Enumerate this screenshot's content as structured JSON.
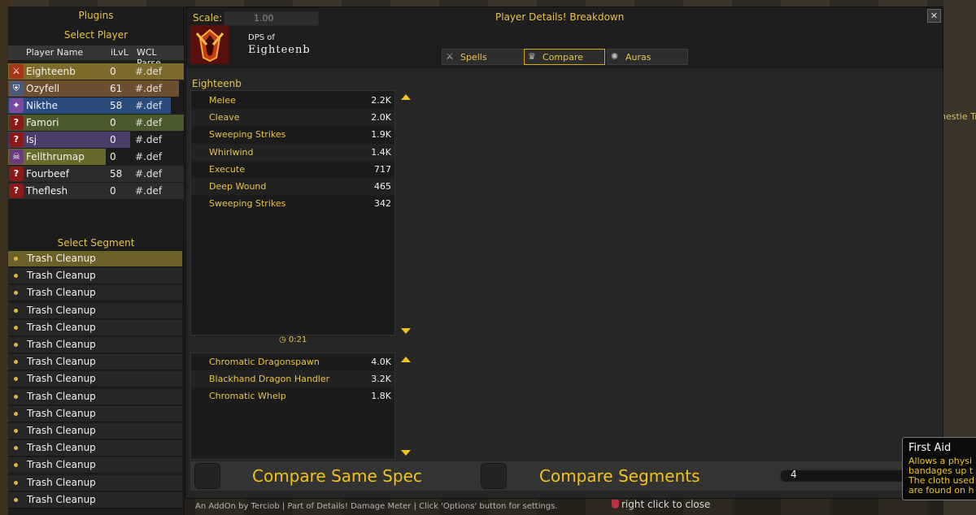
{
  "plugins_title": "Plugins",
  "select_player_title": "Select Player",
  "player_table": {
    "headers": [
      "Player Name",
      "iLvL",
      "WCL Parse"
    ],
    "rows": [
      {
        "name": "Eighteenb",
        "ilvl": "0",
        "parse": "#.def",
        "bar": "#7c6b2a",
        "icon": "warrior-icon"
      },
      {
        "name": "Ozyfell",
        "ilvl": "61",
        "parse": "#.def",
        "bar": "#6d4f30",
        "icon": "shield-icon"
      },
      {
        "name": "Nikthe",
        "ilvl": "58",
        "parse": "#.def",
        "bar": "#2a4c7c",
        "icon": "mage-icon"
      },
      {
        "name": "Famori",
        "ilvl": "0",
        "parse": "#.def",
        "bar": "#4a5a2a",
        "icon": "question-icon"
      },
      {
        "name": "Isj",
        "ilvl": "0",
        "parse": "#.def",
        "bar": "#4a3d6a",
        "icon": "question-icon"
      },
      {
        "name": "Fellthrumap",
        "ilvl": "0",
        "parse": "#.def",
        "bar": "#676a2a",
        "icon": "warlock-icon"
      },
      {
        "name": "Fourbeef",
        "ilvl": "58",
        "parse": "#.def",
        "bar": "#2c2c2c",
        "icon": "question-icon"
      },
      {
        "name": "Theflesh",
        "ilvl": "0",
        "parse": "#.def",
        "bar": "#2c2c2c",
        "icon": "question-icon"
      }
    ]
  },
  "select_segment_title": "Select Segment",
  "segments": [
    "Trash Cleanup",
    "Trash Cleanup",
    "Trash Cleanup",
    "Trash Cleanup",
    "Trash Cleanup",
    "Trash Cleanup",
    "Trash Cleanup",
    "Trash Cleanup",
    "Trash Cleanup",
    "Trash Cleanup",
    "Trash Cleanup",
    "Trash Cleanup",
    "Trash Cleanup",
    "Trash Cleanup",
    "Trash Cleanup"
  ],
  "window": {
    "scale_label": "Scale:",
    "scale_value": "1.00",
    "title": "Player Details! Breakdown",
    "close": "✕",
    "dps_of": "DPS of",
    "player_name": "Eighteenb",
    "tabs": [
      {
        "label": "Spells",
        "icon": "swords-icon"
      },
      {
        "label": "Compare",
        "icon": "crown-icon"
      },
      {
        "label": "Auras",
        "icon": "auras-icon"
      }
    ]
  },
  "breakdown": {
    "player": "Eighteenb",
    "spells": [
      {
        "name": "Melee",
        "value": "2.2K"
      },
      {
        "name": "Cleave",
        "value": "2.0K"
      },
      {
        "name": "Sweeping Strikes",
        "value": "1.9K"
      },
      {
        "name": "Whirlwind",
        "value": "1.4K"
      },
      {
        "name": "Execute",
        "value": "717"
      },
      {
        "name": "Deep Wound",
        "value": "465"
      },
      {
        "name": "Sweeping Strikes",
        "value": "342"
      }
    ],
    "timer": "0:21",
    "targets": [
      {
        "name": "Chromatic Dragonspawn",
        "value": "4.0K"
      },
      {
        "name": "Blackhand Dragon Handler",
        "value": "3.2K"
      },
      {
        "name": "Chromatic Whelp",
        "value": "1.8K"
      }
    ]
  },
  "footer": {
    "compare_same_spec": "Compare Same Spec",
    "compare_segments": "Compare Segments",
    "slider_value": "4"
  },
  "credit": "An AddOn by Terciob | Part of Details! Damage Meter | Click 'Options' button for settings.",
  "close_hint": "right click to close",
  "world_text": "nestie Tr",
  "tooltip": {
    "title": "First Aid",
    "lines": [
      "Allows a physi",
      "bandages up t",
      "The cloth used",
      "are found on h"
    ]
  },
  "colors": {
    "gold": "#e9c34a",
    "accent_border": "#d4a820",
    "panel": "#1f1f1f"
  }
}
